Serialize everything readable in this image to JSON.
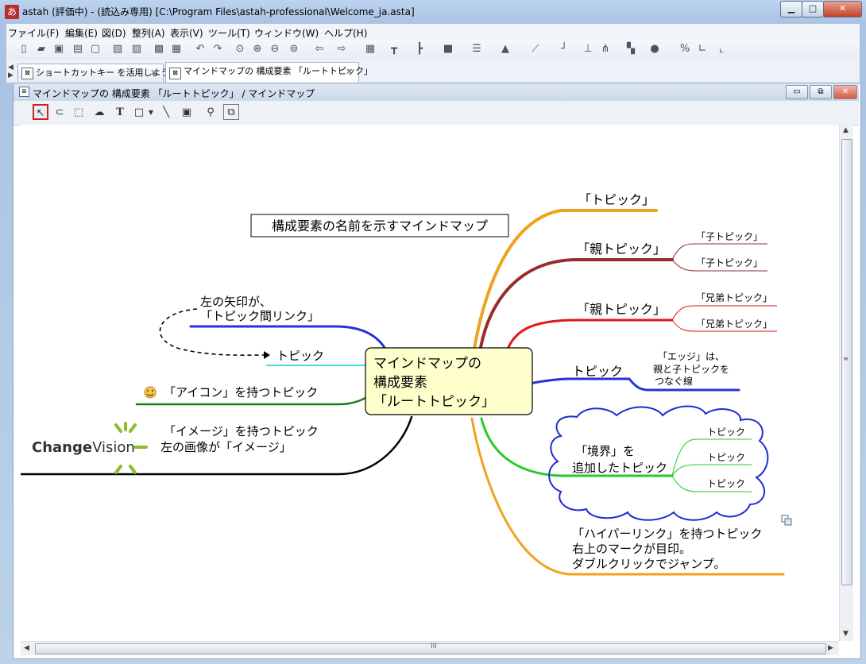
{
  "window": {
    "app_icon": "あ",
    "title": "astah  (評価中)  - (読込み専用) [C:\\Program Files\\astah-professional\\Welcome_ja.asta]",
    "min": "▁",
    "max": "□",
    "close": "✕"
  },
  "menu": [
    "ファイル(F)",
    "編集(E)",
    "図(D)",
    "整列(A)",
    "表示(V)",
    "ツール(T)",
    "ウィンドウ(W)",
    "ヘルプ(H)"
  ],
  "tabs": [
    {
      "label": "ショートカットキー を活用しよう",
      "close": "✕"
    },
    {
      "label": "マインドマップの 構成要素 「ルートトピック」",
      "close": "✕"
    }
  ],
  "inner_window": {
    "title": "マインドマップの 構成要素 「ルートトピック」 / マインドマップ",
    "min": "▭",
    "restore": "⧉",
    "close": "✕"
  },
  "mindmap": {
    "title_box": "構成要素の名前を示すマインドマップ",
    "root": [
      "マインドマップの",
      "構成要素",
      "「ルートトピック」"
    ],
    "left": {
      "link_note": [
        "左の矢印が、",
        "「トピック間リンク」"
      ],
      "linked_topic": "トピック",
      "icon_topic": "「アイコン」を持つトピック",
      "image_topic": [
        "「イメージ」を持つトピック",
        "左の画像が「イメージ」"
      ],
      "logo_text_1": "Change",
      "logo_text_2": "Vision"
    },
    "right": {
      "topic": "「トピック」",
      "parent1": "「親トピック」",
      "children": [
        "「子トピック」",
        "「子トピック」"
      ],
      "parent2": "「親トピック」",
      "siblings": [
        "「兄弟トピック」",
        "「兄弟トピック」"
      ],
      "edge_topic": "トピック",
      "edge_note": [
        "「エッジ」は、",
        "親と子トピックを",
        "つなぐ線"
      ],
      "boundary_topic": [
        "「境界」を",
        "追加したトピック"
      ],
      "boundary_children": [
        "トピック",
        "トピック",
        "トピック"
      ],
      "hyperlink_topic": [
        "「ハイパーリンク」を持つトピック",
        "右上のマークが目印。",
        "ダブルクリックでジャンプ。"
      ]
    }
  },
  "scroll": {
    "h_grip": "III"
  },
  "colors": {
    "orange": "#f0a21f",
    "maroon": "#9b2c2c",
    "red": "#e01818",
    "blue": "#2732d6",
    "green": "#27c92a",
    "cyan": "#3ddde8",
    "darkgreen": "#1c7a1c",
    "black": "#000000",
    "root_fill": "#ffffcc",
    "logo_green": "#8bbd2b"
  }
}
